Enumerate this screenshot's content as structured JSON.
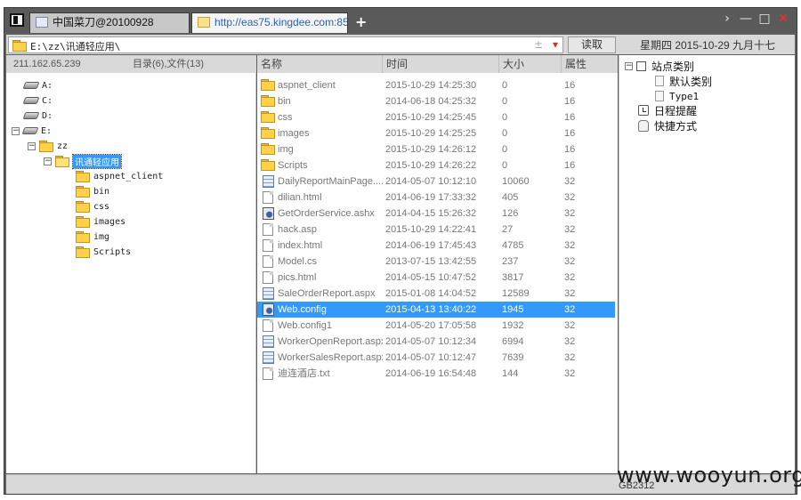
{
  "window": {
    "tabs": [
      {
        "label": "中国菜刀@20100928"
      },
      {
        "label": "http://eas75.kingdee.com:85..."
      }
    ],
    "new_tab": "+",
    "controls": {
      "next": "›",
      "minimize": "—",
      "maximize": "□",
      "close": "✕"
    }
  },
  "address_bar": {
    "path": "E:\\zz\\讯通轻应用\\",
    "plus_minus": "±",
    "dropdown": "▾",
    "read_button": "读取",
    "datetime": "星期四 2015-10-29 九月十七"
  },
  "left_pane": {
    "ip": "211.162.65.239",
    "count": "目录(6),文件(13)",
    "drives": [
      "A:",
      "C:",
      "D:",
      "E:"
    ],
    "expanders": {
      "collapsed": "+",
      "expanded": "−"
    },
    "tree": {
      "zz": "zz",
      "selected": "讯通轻应用",
      "children": [
        "aspnet_client",
        "bin",
        "css",
        "images",
        "img",
        "Scripts"
      ]
    }
  },
  "file_list": {
    "columns": {
      "name": "名称",
      "time": "时间",
      "size": "大小",
      "attr": "属性"
    },
    "rows": [
      {
        "icon": "folder-icon",
        "name": "aspnet_client",
        "time": "2015-10-29 14:25:30",
        "size": "0",
        "attr": "16"
      },
      {
        "icon": "folder-icon",
        "name": "bin",
        "time": "2014-06-18 04:25:32",
        "size": "0",
        "attr": "16"
      },
      {
        "icon": "folder-icon",
        "name": "css",
        "time": "2015-10-29 14:25:45",
        "size": "0",
        "attr": "16"
      },
      {
        "icon": "folder-icon",
        "name": "images",
        "time": "2015-10-29 14:25:25",
        "size": "0",
        "attr": "16"
      },
      {
        "icon": "folder-icon",
        "name": "img",
        "time": "2015-10-29 14:26:12",
        "size": "0",
        "attr": "16"
      },
      {
        "icon": "folder-icon",
        "name": "Scripts",
        "time": "2015-10-29 14:26:22",
        "size": "0",
        "attr": "16"
      },
      {
        "icon": "grid-file-icon",
        "name": "DailyReportMainPage....",
        "time": "2014-05-07 10:12:10",
        "size": "10060",
        "attr": "32"
      },
      {
        "icon": "file-icon",
        "name": "dilian.html",
        "time": "2014-06-19 17:33:32",
        "size": "405",
        "attr": "32"
      },
      {
        "icon": "gear-file-icon",
        "name": "GetOrderService.ashx",
        "time": "2014-04-15 15:26:32",
        "size": "126",
        "attr": "32"
      },
      {
        "icon": "file-icon",
        "name": "hack.asp",
        "time": "2015-10-29 14:22:41",
        "size": "27",
        "attr": "32"
      },
      {
        "icon": "file-icon",
        "name": "index.html",
        "time": "2014-06-19 17:45:43",
        "size": "4785",
        "attr": "32"
      },
      {
        "icon": "file-icon",
        "name": "Model.cs",
        "time": "2013-07-15 13:42:55",
        "size": "237",
        "attr": "32"
      },
      {
        "icon": "file-icon",
        "name": "pics.html",
        "time": "2014-05-15 10:47:52",
        "size": "3817",
        "attr": "32"
      },
      {
        "icon": "grid-file-icon",
        "name": "SaleOrderReport.aspx",
        "time": "2015-01-08 14:04:52",
        "size": "12589",
        "attr": "32"
      },
      {
        "icon": "gear-file-icon",
        "name": "Web.config",
        "time": "2015-04-13 13:40:22",
        "size": "1945",
        "attr": "32",
        "selected": true
      },
      {
        "icon": "file-icon",
        "name": "Web.config1",
        "time": "2014-05-20 17:05:58",
        "size": "1932",
        "attr": "32"
      },
      {
        "icon": "grid-file-icon",
        "name": "WorkerOpenReport.aspx",
        "time": "2014-05-07 10:12:34",
        "size": "6994",
        "attr": "32"
      },
      {
        "icon": "grid-file-icon",
        "name": "WorkerSalesReport.aspx",
        "time": "2014-05-07 10:12:47",
        "size": "7639",
        "attr": "32"
      },
      {
        "icon": "file-icon",
        "name": "迪连酒店.txt",
        "time": "2014-06-19 16:54:48",
        "size": "144",
        "attr": "32"
      }
    ]
  },
  "right_pane": {
    "site_category": "站点类别",
    "default_category": "默认类别",
    "type1": "Type1",
    "schedule": "日程提醒",
    "shortcuts": "快捷方式"
  },
  "status_bar": {
    "encoding": "GB2312"
  },
  "watermark": "www.wooyun.org"
}
